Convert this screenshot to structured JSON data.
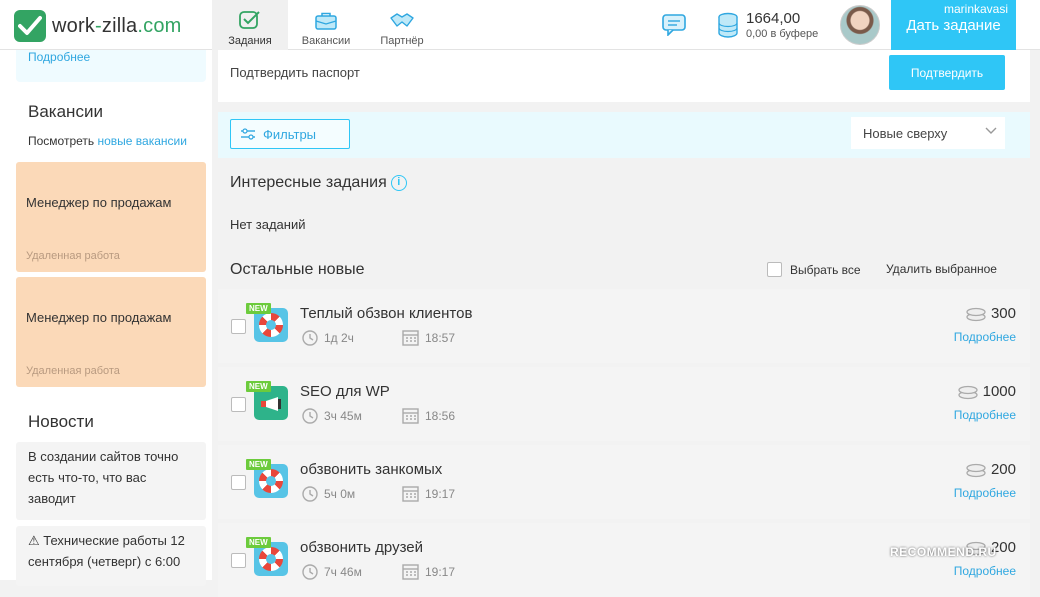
{
  "header": {
    "logo_main": "work",
    "logo_sep": "-",
    "logo_brand": "zilla",
    "logo_tld": ".com",
    "nav": [
      {
        "label": "Задания",
        "icon": "check-square-icon"
      },
      {
        "label": "Вакансии",
        "icon": "briefcase-icon"
      },
      {
        "label": "Партнёр",
        "icon": "handshake-icon"
      }
    ],
    "balance_amount": "1664,00",
    "balance_buffer": "0,00 в буфере",
    "give_task_label": "Дать задание",
    "username": "marinkavasi"
  },
  "sidebar": {
    "more_link": "Подробнее",
    "vacancies_title": "Вакансии",
    "vacancies_prefix": "Посмотреть",
    "vacancies_link": "новые вакансии",
    "vacancies": [
      {
        "title": "Менеджер по продажам",
        "type": "Удаленная работа"
      },
      {
        "title": "Менеджер по продажам",
        "type": "Удаленная работа"
      }
    ],
    "news_title": "Новости",
    "news": [
      "В создании сайтов точно есть что-то, что вас заводит",
      "⚠ Технические работы 12 сентября (четверг) с 6:00"
    ]
  },
  "main": {
    "confirm_text": "Подтвердить паспорт",
    "confirm_button": "Подтвердить",
    "filters_label": "Фильтры",
    "sort_value": "Новые сверху",
    "interesting_title": "Интересные задания",
    "interesting_info": "i",
    "no_tasks": "Нет заданий",
    "other_title": "Остальные новые",
    "select_all": "Выбрать все",
    "delete_selected": "Удалить выбранное",
    "more_label": "Подробнее",
    "new_badge": "NEW",
    "tasks": [
      {
        "title": "Теплый обзвон клиентов",
        "duration": "1д 2ч",
        "time": "18:57",
        "price": "300",
        "icon": "lifebuoy-icon"
      },
      {
        "title": "SEO для WP",
        "duration": "3ч 45м",
        "time": "18:56",
        "price": "1000",
        "icon": "megaphone-icon"
      },
      {
        "title": "обзвонить занкомых",
        "duration": "5ч 0м",
        "time": "19:17",
        "price": "200",
        "icon": "lifebuoy-icon"
      },
      {
        "title": "обзвонить друзей",
        "duration": "7ч 46м",
        "time": "19:17",
        "price": "200",
        "icon": "lifebuoy-icon"
      }
    ]
  },
  "watermark": "RECOMMEND.RU",
  "colors": {
    "accent": "#2fc6f6",
    "brand_green": "#33a463",
    "vacancy_bg": "#fbd9b8"
  }
}
